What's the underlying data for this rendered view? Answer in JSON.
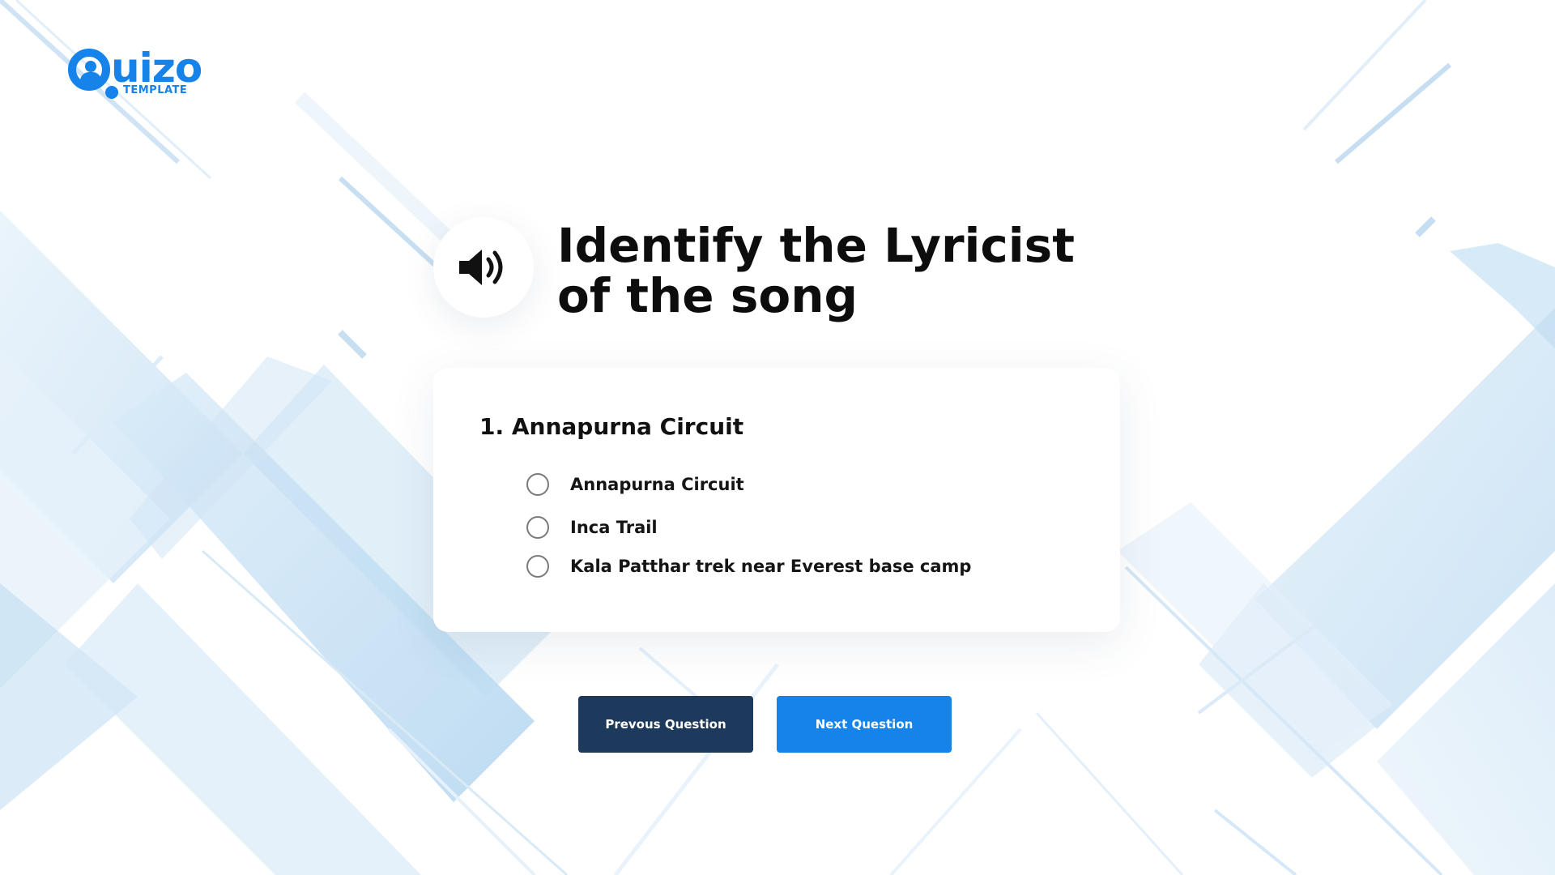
{
  "logo": {
    "brand_rest": "uizo",
    "subtitle": "TEMPLATE"
  },
  "question": {
    "title": "Identify the Lyricist of the song",
    "speaker_icon": "speaker-volume-icon"
  },
  "card": {
    "heading": "1. Annapurna Circuit",
    "options": [
      {
        "label": "Annapurna Circuit",
        "selected": false
      },
      {
        "label": "Inca Trail",
        "selected": false
      },
      {
        "label": "Kala Patthar trek near Everest base camp",
        "selected": false
      }
    ]
  },
  "buttons": {
    "previous": "Prevous Question",
    "next": "Next Question"
  },
  "colors": {
    "accent": "#1583e9",
    "dark_button": "#1d3a5c",
    "background_shapes": "#bcdcf2"
  }
}
